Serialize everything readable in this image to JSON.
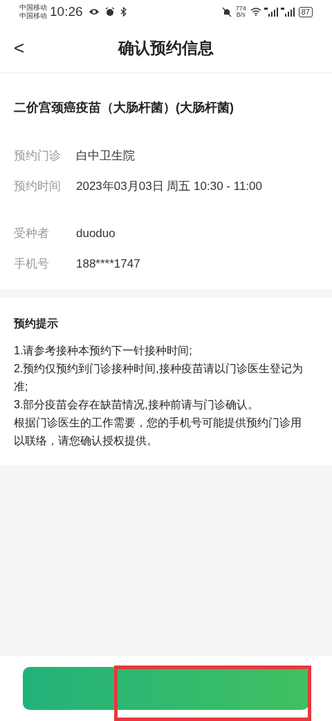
{
  "status_bar": {
    "carriers": [
      "中国移动",
      "中国移动"
    ],
    "time": "10:26",
    "speed": [
      "774",
      "B/s"
    ],
    "battery": "87"
  },
  "header": {
    "back": "<",
    "title": "确认预约信息"
  },
  "vaccine": {
    "name": "二价宫颈癌疫苗（大肠杆菌）(大肠杆菌)"
  },
  "appointment": [
    {
      "label": "预约门诊",
      "value": "白中卫生院"
    },
    {
      "label": "预约时间",
      "value": "2023年03月03日 周五 10:30 - 11:00"
    }
  ],
  "recipient": [
    {
      "label": "受种者",
      "value": "duoduo"
    },
    {
      "label": "手机号",
      "value": "188****1747"
    }
  ],
  "notice": {
    "title": "预约提示",
    "lines": [
      "1.请参考接种本预约下一针接种时间;",
      "2.预约仅预约到门诊接种时间,接种疫苗请以门诊医生登记为准;",
      "3.部分疫苗会存在缺苗情况,接种前请与门诊确认。",
      "根据门诊医生的工作需要，您的手机号可能提供预约门诊用以联络，请您确认授权提供。"
    ]
  },
  "footer": {
    "highlighted": true
  }
}
